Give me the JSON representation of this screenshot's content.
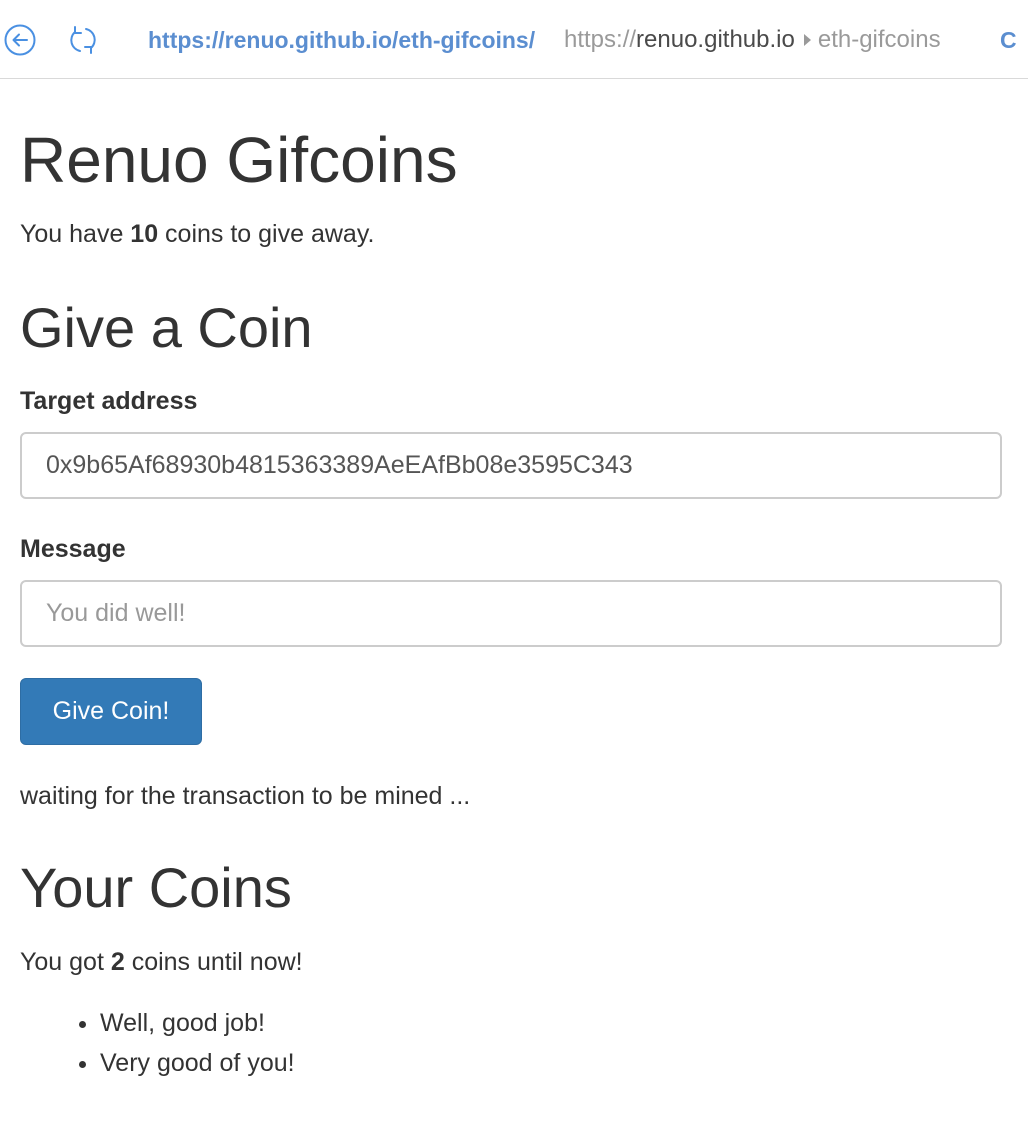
{
  "browser": {
    "url": "https://renuo.github.io/eth-gifcoins/",
    "breadcrumb": {
      "scheme": "https://",
      "host": "renuo.github.io",
      "path": "eth-gifcoins"
    },
    "cut_label": "C"
  },
  "page": {
    "title": "Renuo Gifcoins",
    "balance": {
      "prefix": "You have ",
      "count": "10",
      "suffix": " coins to give away."
    },
    "give": {
      "heading": "Give a Coin",
      "target_label": "Target address",
      "target_value": "0x9b65Af68930b4815363389AeEAfBb08e3595C343",
      "message_label": "Message",
      "message_placeholder": "You did well!",
      "button_label": "Give Coin!",
      "status": "waiting for the transaction to be mined ..."
    },
    "received": {
      "heading": "Your Coins",
      "prefix": "You got ",
      "count": "2",
      "suffix": " coins until now!",
      "messages": [
        "Well, good job!",
        "Very good of you!"
      ]
    }
  },
  "colors": {
    "accent": "#337ab7",
    "link": "#5b8ed0",
    "text": "#333333"
  }
}
